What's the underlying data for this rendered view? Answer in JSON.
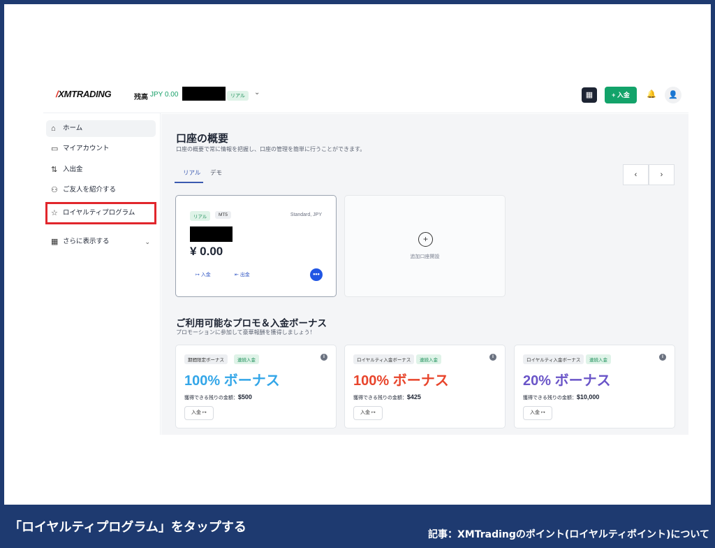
{
  "header": {
    "logo": "XMTRADING",
    "balance_label": "残高",
    "balance_value": "JPY 0.00",
    "account_badge": "リアル",
    "deposit_button": "+ 入金"
  },
  "sidebar": {
    "items": [
      {
        "label": "ホーム",
        "icon": "home-icon"
      },
      {
        "label": "マイアカウント",
        "icon": "card-icon"
      },
      {
        "label": "入出金",
        "icon": "transfer-icon"
      },
      {
        "label": "ご友人を紹介する",
        "icon": "people-icon"
      },
      {
        "label": "ロイヤルティプログラム",
        "icon": "star-icon"
      },
      {
        "label": "さらに表示する",
        "icon": "grid-icon"
      }
    ]
  },
  "overview": {
    "title": "口座の概要",
    "subtitle": "口座の概要で常に情報を把握し、口座の管理を簡単に行うことができます。",
    "tabs": [
      "リアル",
      "デモ"
    ]
  },
  "account_card": {
    "badge_type": "リアル",
    "badge_platform": "MT5",
    "account_type": "Standard, JPY",
    "balance": "¥ 0.00",
    "deposit": "入金",
    "withdraw": "出金"
  },
  "add_account": {
    "label": "追加口座開設"
  },
  "promos": {
    "title": "ご利用可能なプロモ＆入金ボーナス",
    "subtitle": "プロモーションに参加して豪華報酬を獲得しましょう！",
    "cards": [
      {
        "tag1": "期間限定ボーナス",
        "tag2": "連続入金",
        "headline": "100% ボーナス",
        "remaining_label": "獲得できる残りの金額：",
        "remaining": "$500",
        "button": "入金",
        "color": "#33a6e8"
      },
      {
        "tag1": "ロイヤルティ入金ボーナス",
        "tag2": "連続入金",
        "headline": "100% ボーナス",
        "remaining_label": "獲得できる残りの金額：",
        "remaining": "$425",
        "button": "入金",
        "color": "#e8452c"
      },
      {
        "tag1": "ロイヤルティ入金ボーナス",
        "tag2": "連続入金",
        "headline": "20% ボーナス",
        "remaining_label": "獲得できる残りの金額：",
        "remaining": "$10,000",
        "button": "入金",
        "color": "#6a55c8"
      }
    ]
  },
  "captions": {
    "left": "「ロイヤルティプログラム」をタップする",
    "right": "記事：XMTradingのポイント(ロイヤルティポイント)について"
  }
}
